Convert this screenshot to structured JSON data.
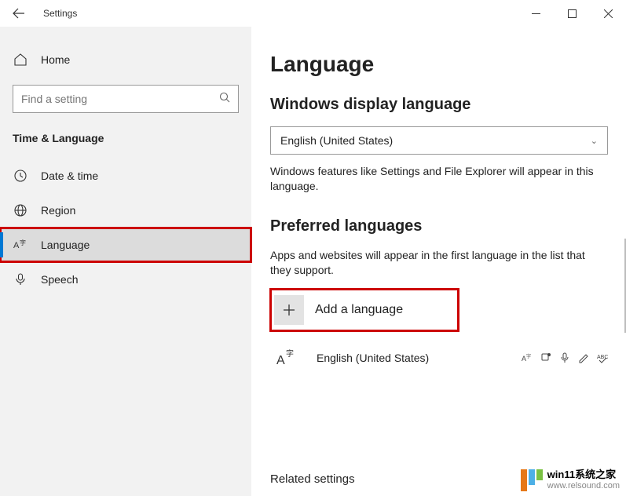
{
  "titlebar": {
    "title": "Settings"
  },
  "sidebar": {
    "home": "Home",
    "search_placeholder": "Find a setting",
    "section": "Time & Language",
    "items": [
      {
        "label": "Date & time"
      },
      {
        "label": "Region"
      },
      {
        "label": "Language"
      },
      {
        "label": "Speech"
      }
    ]
  },
  "main": {
    "h1": "Language",
    "display_h2": "Windows display language",
    "display_value": "English (United States)",
    "display_desc": "Windows features like Settings and File Explorer will appear in this language.",
    "pref_h2": "Preferred languages",
    "pref_desc": "Apps and websites will appear in the first language in the list that they support.",
    "add_label": "Add a language",
    "lang0": "English (United States)",
    "related": "Related settings"
  },
  "watermark": {
    "line1": "win11系统之家",
    "line2": "www.relsound.com"
  }
}
